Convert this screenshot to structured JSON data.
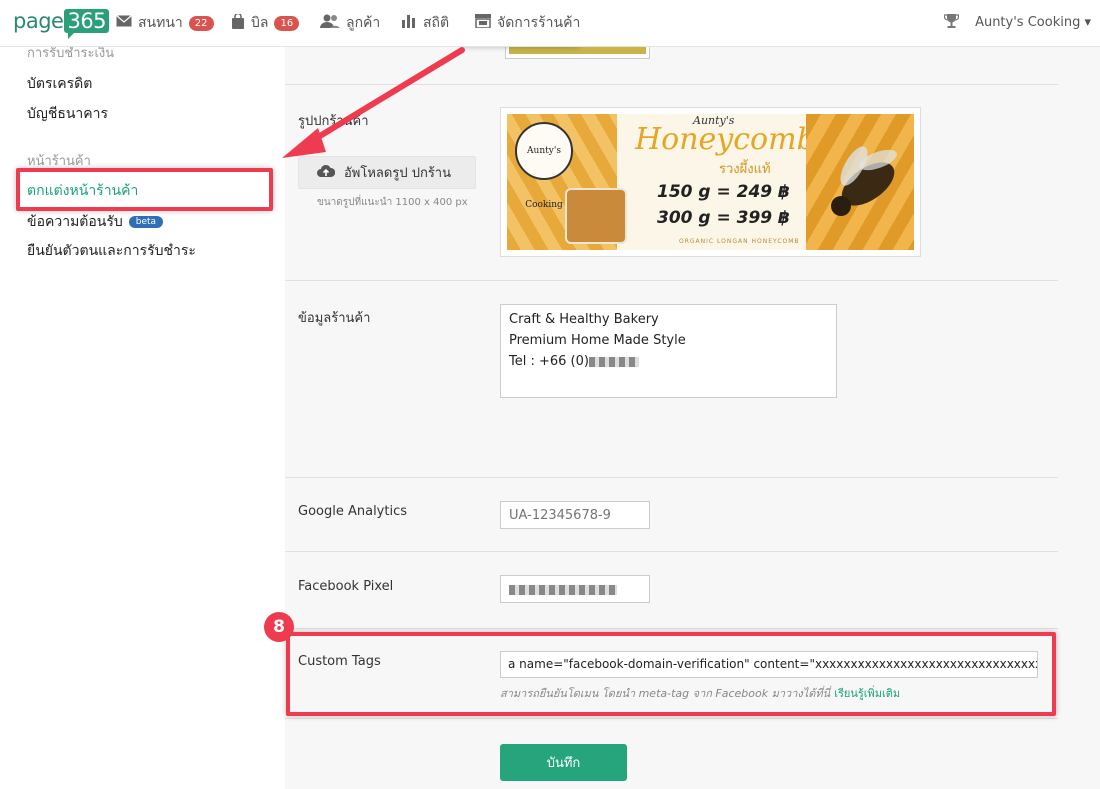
{
  "colors": {
    "accent": "#1aa37a",
    "highlight": "#ef3b4f",
    "badge": "#d9534f",
    "beta": "#2f6fb5",
    "primary_button": "#26a57c"
  },
  "brand": {
    "name": "page",
    "number": "365"
  },
  "nav": {
    "chat": {
      "label": "สนทนา",
      "badge": "22",
      "icon": "envelope-icon"
    },
    "bill": {
      "label": "บิล",
      "badge": "16",
      "icon": "bag-icon"
    },
    "customers": {
      "label": "ลูกค้า",
      "icon": "users-icon"
    },
    "stats": {
      "label": "สถิติ",
      "icon": "bar-chart-icon"
    },
    "store": {
      "label": "จัดการร้านค้า",
      "icon": "store-icon"
    },
    "account": {
      "label": "Aunty's Cooking"
    }
  },
  "sidebar": {
    "payments_head": "การรับชำระเงิน",
    "credit_card": "บัตรเครดิต",
    "bank_account": "บัญชีธนาคาร",
    "storefront_head": "หน้าร้านค้า",
    "decorate": "ตกแต่งหน้าร้านค้า",
    "welcome_message": "ข้อความต้อนรับ",
    "beta": "beta",
    "verify": "ยืนยันตัวตนและการรับชำระ"
  },
  "form": {
    "cover_label": "รูปปกร้านค้า",
    "upload_button": "อัพโหลดรูป ปกร้าน",
    "upload_hint": "ขนาดรูปที่แนะนำ 1100 x 400 px",
    "cover_image": {
      "brand": "Aunty's Cooking",
      "title": "Aunty's",
      "title2": "Honeycomb",
      "subtitle": "รวงผึ้งแท้",
      "price1": "150 g = 249 ฿",
      "price2": "300 g = 399 ฿",
      "footer": "ORGANIC LONGAN HONEYCOMB"
    },
    "info_label": "ข้อมูลร้านค้า",
    "info_lines": [
      "Craft & Healthy Bakery",
      "Premium Home Made Style",
      "Tel : +66 (0)"
    ],
    "ga_label": "Google Analytics",
    "ga_placeholder": "UA-12345678-9",
    "fb_pixel_label": "Facebook Pixel",
    "custom_tags_label": "Custom Tags",
    "custom_tags_value": "a name=\"facebook-domain-verification\" content=\"xxxxxxxxxxxxxxxxxxxxxxxxxxxxxxxxxx\" />",
    "custom_tags_hint": "สามารถยืนยันโดเมน โดยนำ meta-tag จาก Facebook มาวางได้ที่นี่",
    "learn_more": "เรียนรู้เพิ่มเติม",
    "save": "บันทึก"
  },
  "annotation": {
    "step": "8"
  }
}
